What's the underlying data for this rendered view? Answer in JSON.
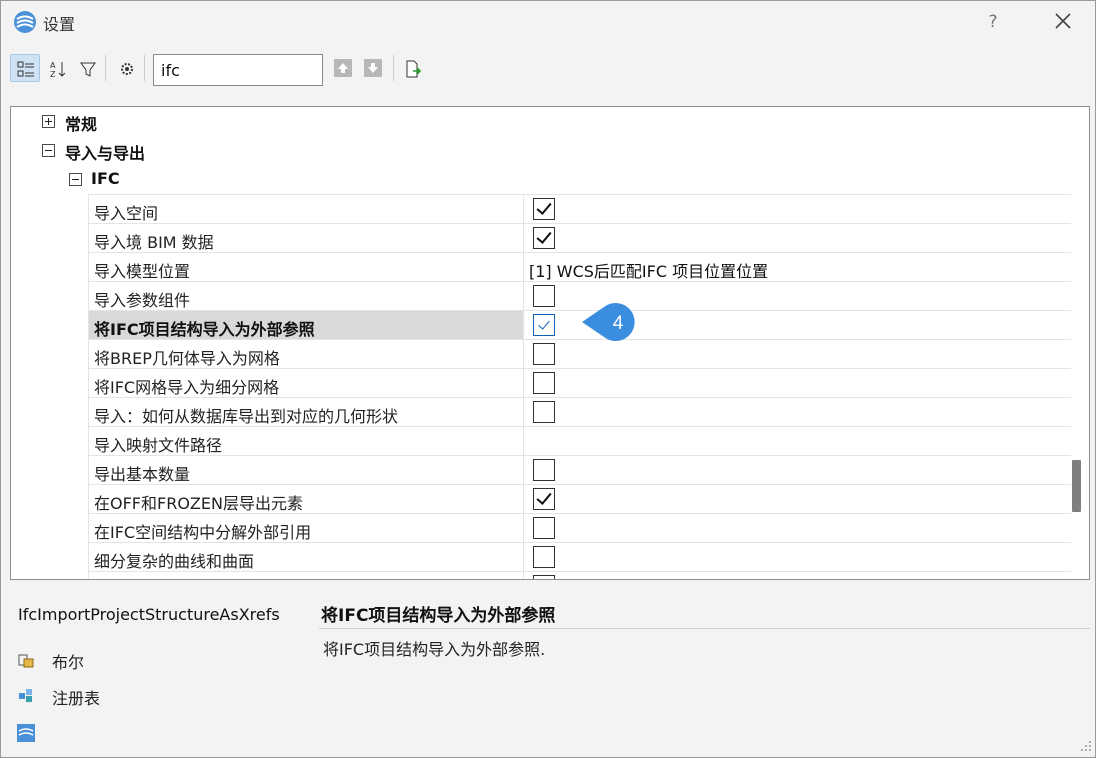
{
  "window": {
    "title": "设置",
    "help_label": "?",
    "close_icon": "close-icon"
  },
  "toolbar": {
    "search_value": "ifc",
    "buttons": [
      "categorized-view-icon",
      "alphabetical-view-icon",
      "filter-icon",
      "settings-icon",
      "previous-icon",
      "next-icon",
      "export-icon"
    ]
  },
  "tree": {
    "groups": [
      {
        "label": "常规",
        "expanded": false
      },
      {
        "label": "导入与导出",
        "expanded": true
      },
      {
        "label": "IFC",
        "expanded": true
      }
    ],
    "rows": [
      {
        "name": "导入空间",
        "type": "checkbox",
        "checked": true
      },
      {
        "name": "导入境 BIM 数据",
        "type": "checkbox",
        "checked": true
      },
      {
        "name": "导入模型位置",
        "type": "text",
        "value": "[1] WCS后匹配IFC 项目位置位置"
      },
      {
        "name": "导入参数组件",
        "type": "checkbox",
        "checked": false
      },
      {
        "name": "将IFC项目结构导入为外部参照",
        "type": "checkbox",
        "checked": true,
        "selected": true
      },
      {
        "name": "将BREP几何体导入为网格",
        "type": "checkbox",
        "checked": false
      },
      {
        "name": "将IFC网格导入为细分网格",
        "type": "checkbox",
        "checked": false
      },
      {
        "name": "导入：如何从数据库导出到对应的几何形状",
        "type": "checkbox",
        "checked": false
      },
      {
        "name": "导入映射文件路径",
        "type": "text",
        "value": ""
      },
      {
        "name": "导出基本数量",
        "type": "checkbox",
        "checked": false
      },
      {
        "name": "在OFF和FROZEN层导出元素",
        "type": "checkbox",
        "checked": true
      },
      {
        "name": "在IFC空间结构中分解外部引用",
        "type": "checkbox",
        "checked": false
      },
      {
        "name": "细分复杂的曲线和曲面",
        "type": "checkbox",
        "checked": false
      }
    ],
    "callout_number": "4"
  },
  "info": {
    "key": "IfcImportProjectStructureAsXrefs",
    "title": "将IFC项目结构导入为外部参照",
    "description": "将IFC项目结构导入为外部参照.",
    "type_label": "布尔",
    "storage_label": "注册表"
  },
  "colors": {
    "accent": "#2f86e0",
    "selected_row": "#d9d9d9",
    "toolbar_active": "#cfe3f5"
  }
}
